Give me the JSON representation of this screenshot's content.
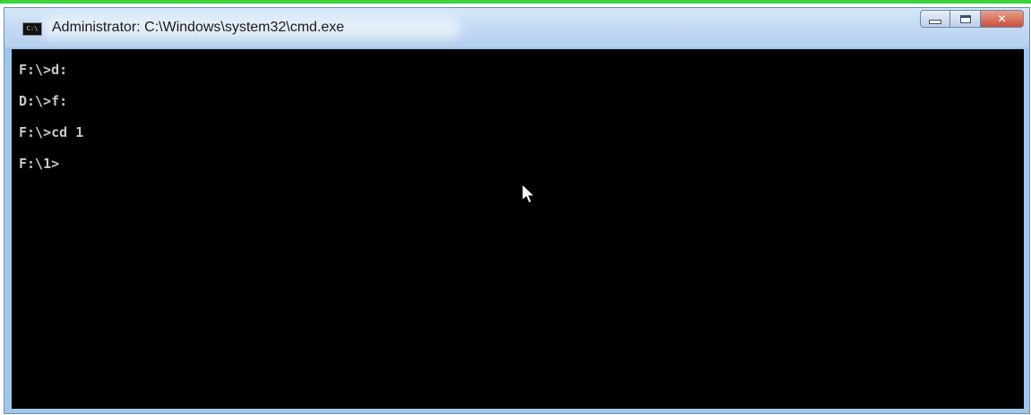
{
  "window": {
    "title": "Administrator: C:\\Windows\\system32\\cmd.exe",
    "icon": "C:\\"
  },
  "controls": {
    "close_label": "✕"
  },
  "console": {
    "lines": [
      "F:\\>d:",
      "D:\\>f:",
      "F:\\>cd 1",
      "F:\\1>"
    ]
  },
  "colors": {
    "accent_top": "#3cd23c",
    "console_bg": "#000000",
    "console_text": "#c8c8c8",
    "close_button": "#c9503a"
  },
  "icons": {
    "app": "cmd-app-icon",
    "minimize": "minimize-icon",
    "maximize": "maximize-icon",
    "close": "close-icon",
    "cursor": "mouse-pointer-icon"
  }
}
